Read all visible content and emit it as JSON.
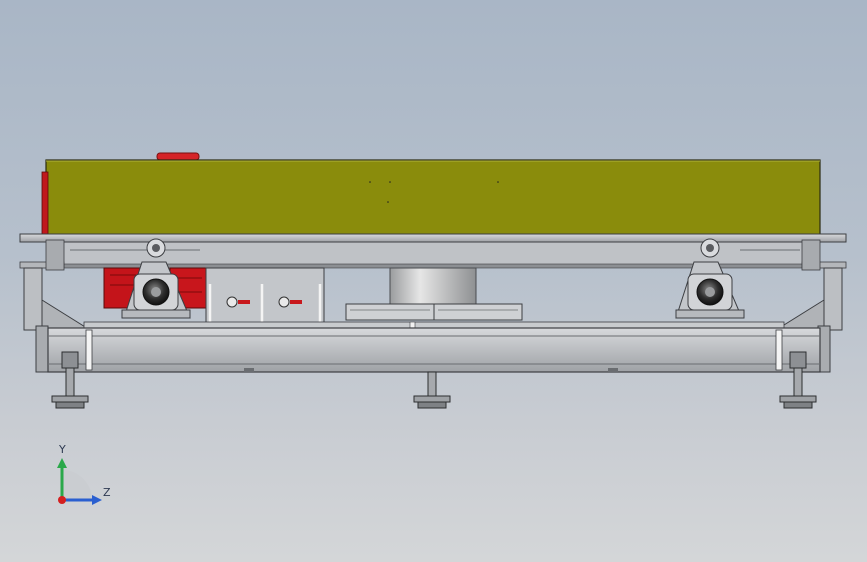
{
  "viewport": {
    "colors": {
      "bg_top": "#a9b6c6",
      "bg_bottom": "#d4d6d8",
      "deck": "#8a8c0c",
      "frame": "#b9bcc0",
      "frame_dark": "#55585c",
      "motor": "#c4141a",
      "bearing": "#2a2a2a"
    }
  },
  "triad": {
    "y_label": "Y",
    "z_label": "Z",
    "y_color": "#2aa84a",
    "z_color": "#2a5fd0",
    "origin_color": "#d42020"
  }
}
